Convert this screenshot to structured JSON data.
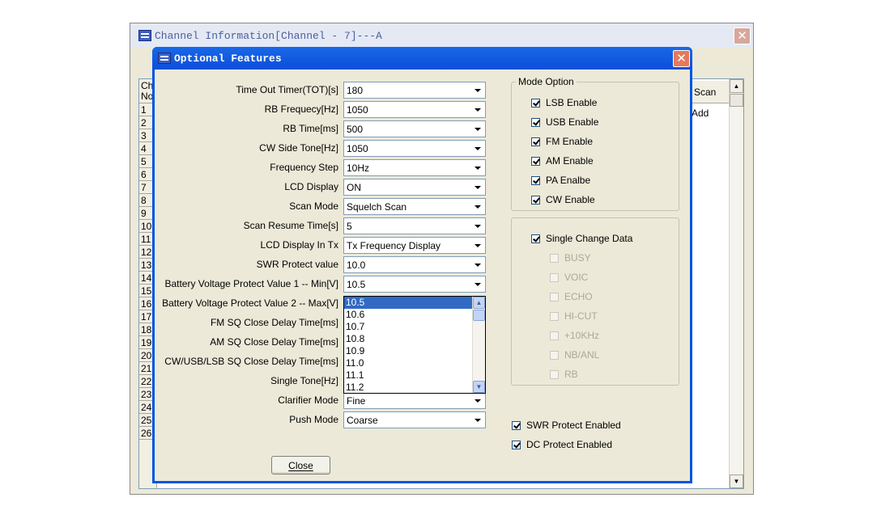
{
  "parent_window": {
    "title": "Channel Information[Channel - 7]---A",
    "column_scan_header": "Scan",
    "scan_first_value": "Add",
    "row_numbers": [
      "Ch\nNo",
      "1",
      "2",
      "3",
      "4",
      "5",
      "6",
      "7",
      "8",
      "9",
      "10",
      "11",
      "12",
      "13",
      "14",
      "15",
      "16",
      "17",
      "18",
      "19",
      "20",
      "21",
      "22",
      "23",
      "24",
      "25",
      "26"
    ]
  },
  "dialog": {
    "title": "Optional Features",
    "close_label": "Close",
    "fields": [
      {
        "label": "Time Out Timer(TOT)[s]",
        "value": "180"
      },
      {
        "label": "RB Frequecy[Hz]",
        "value": "1050"
      },
      {
        "label": "RB Time[ms]",
        "value": "500"
      },
      {
        "label": "CW Side Tone[Hz]",
        "value": "1050"
      },
      {
        "label": "Frequency Step",
        "value": "10Hz"
      },
      {
        "label": "LCD Display",
        "value": "ON"
      },
      {
        "label": "Scan Mode",
        "value": "Squelch Scan"
      },
      {
        "label": "Scan Resume Time[s]",
        "value": "5"
      },
      {
        "label": "LCD Display In Tx",
        "value": "Tx Frequency Display"
      },
      {
        "label": "SWR Protect value",
        "value": "10.0"
      },
      {
        "label": "Battery Voltage Protect Value 1 -- Min[V]",
        "value": "10.5"
      },
      {
        "label": "Battery Voltage Protect Value 2 -- Max[V]",
        "value": ""
      },
      {
        "label": "FM SQ Close Delay Time[ms]",
        "value": ""
      },
      {
        "label": "AM SQ Close Delay Time[ms]",
        "value": ""
      },
      {
        "label": "CW/USB/LSB SQ Close Delay Time[ms]",
        "value": ""
      },
      {
        "label": "Single Tone[Hz]",
        "value": ""
      },
      {
        "label": "Clarifier Mode",
        "value": "Fine"
      },
      {
        "label": "Push Mode",
        "value": "Coarse"
      }
    ],
    "dropdown": {
      "options": [
        "10.5",
        "10.6",
        "10.7",
        "10.8",
        "10.9",
        "11.0",
        "11.1",
        "11.2"
      ],
      "selected": "10.5"
    },
    "mode_option": {
      "legend": "Mode Option",
      "items": [
        {
          "label": "LSB Enable",
          "checked": true
        },
        {
          "label": "USB Enable",
          "checked": true
        },
        {
          "label": "FM Enable",
          "checked": true
        },
        {
          "label": "AM Enable",
          "checked": true
        },
        {
          "label": "PA Enalbe",
          "checked": true
        },
        {
          "label": "CW Enable",
          "checked": true
        }
      ]
    },
    "single_change": {
      "label": "Single Change Data",
      "checked": true,
      "items": [
        {
          "label": "BUSY",
          "checked": false
        },
        {
          "label": "VOIC",
          "checked": false
        },
        {
          "label": "ECHO",
          "checked": false
        },
        {
          "label": "HI-CUT",
          "checked": false
        },
        {
          "label": "+10KHz",
          "checked": false
        },
        {
          "label": "NB/ANL",
          "checked": false
        },
        {
          "label": "RB",
          "checked": false
        }
      ]
    },
    "swr_protect": {
      "label": "SWR Protect Enabled",
      "checked": true
    },
    "dc_protect": {
      "label": "DC Protect Enabled",
      "checked": true
    }
  }
}
